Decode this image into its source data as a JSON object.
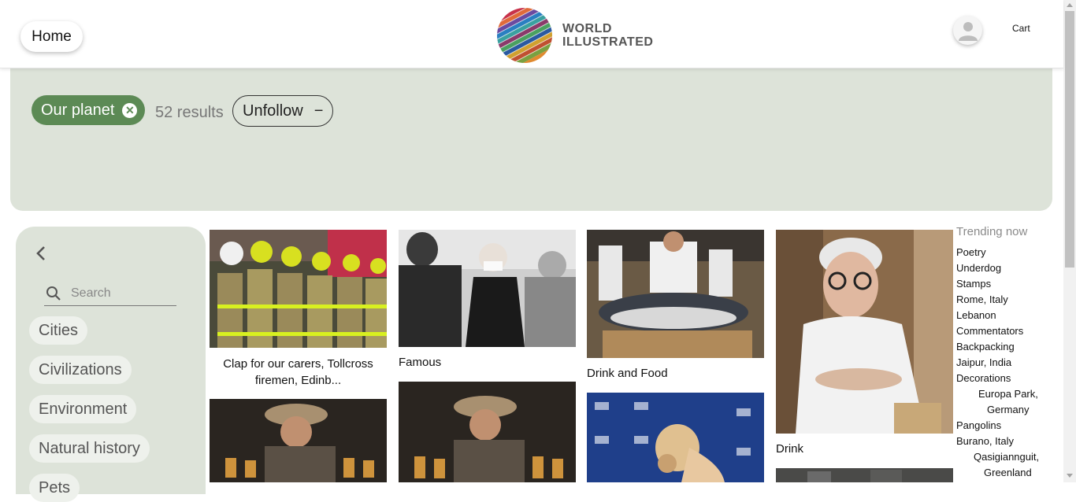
{
  "header": {
    "home_label": "Home",
    "logo_line1": "WORLD",
    "logo_line2": "ILLUSTRATED",
    "cart_label": "Cart"
  },
  "filter": {
    "tag_label": "Our planet",
    "results_text": "52 results",
    "unfollow_label": "Unfollow",
    "unfollow_symbol": "−"
  },
  "sidebar": {
    "back_symbol": "‹",
    "search_placeholder": "Search",
    "categories": [
      "Cities",
      "Civilizations",
      "Environment",
      "Natural history",
      "Pets"
    ]
  },
  "grid": {
    "captions": [
      "Clap for our carers, Tollcross firemen, Edinb...",
      "Famous",
      "Drink and Food",
      "Drink"
    ]
  },
  "trending": {
    "title": "Trending now",
    "items": [
      "Poetry",
      "Underdog",
      "Stamps",
      "Rome, Italy",
      "Lebanon",
      "Commentators",
      "Backpacking",
      "Jaipur, India",
      "Decorations",
      "Europa Park,",
      "Germany",
      "Pangolins",
      "Burano, Italy",
      "Qasigiannguit,",
      "Greenland"
    ]
  },
  "colors": {
    "panel": "#dde3d9",
    "accent": "#5c8a55",
    "chip": "#eef1ec"
  }
}
